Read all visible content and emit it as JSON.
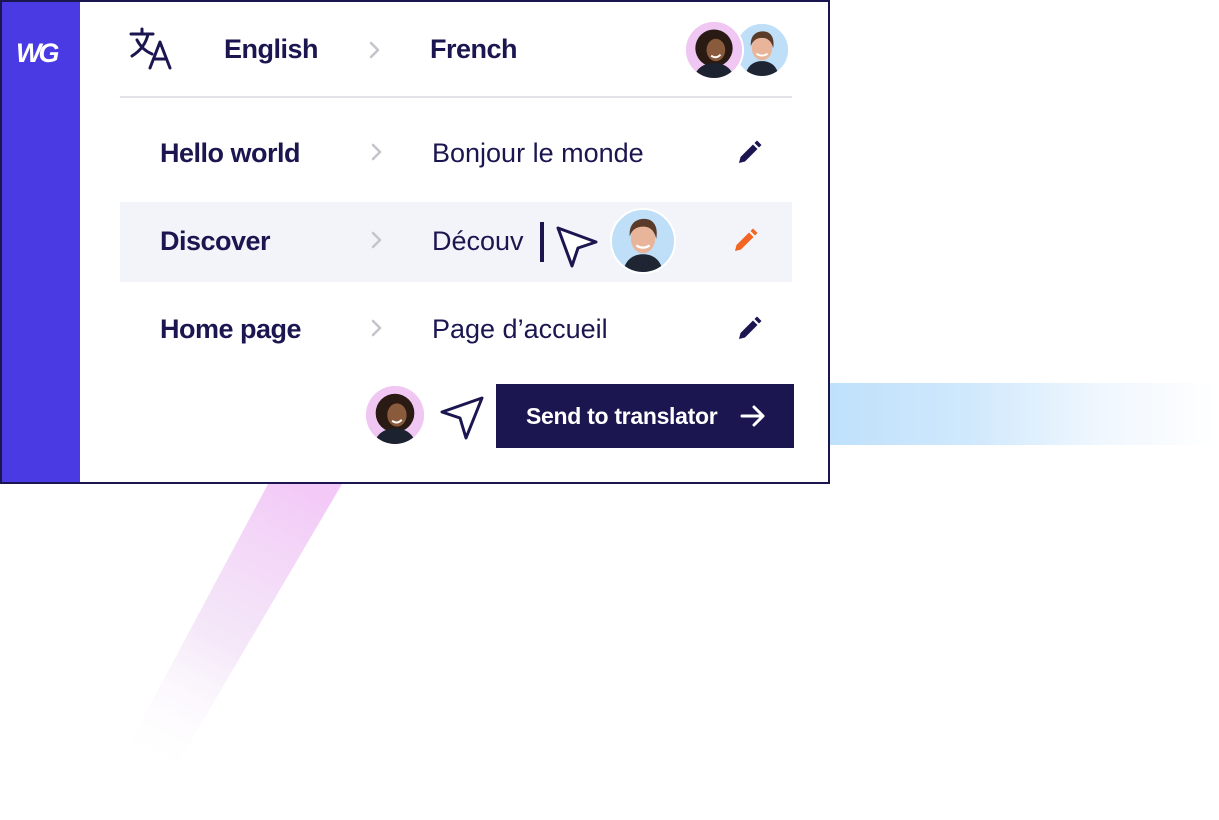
{
  "sidebar": {
    "logo_text": "WG"
  },
  "header": {
    "source_language": "English",
    "target_language": "French",
    "icons": {
      "translate": "translate-icon",
      "separator": "chevron-right-icon"
    }
  },
  "rows": [
    {
      "source": "Hello world",
      "target": "Bonjour le monde",
      "edit_icon": "pencil-icon",
      "edit_color": "#1b1650"
    },
    {
      "source": "Discover",
      "target": "Découv",
      "edit_icon": "pencil-icon",
      "edit_color": "#f26522"
    },
    {
      "source": "Home page",
      "target": "Page d’accueil",
      "edit_icon": "pencil-icon",
      "edit_color": "#1b1650"
    }
  ],
  "footer": {
    "send_button_label": "Send to translator",
    "send_icon": "arrow-right-icon"
  },
  "colors": {
    "brand": "#4a3ae3",
    "navy": "#1b1650",
    "accent_edit": "#f26522",
    "row_highlight": "#f3f4f9"
  }
}
